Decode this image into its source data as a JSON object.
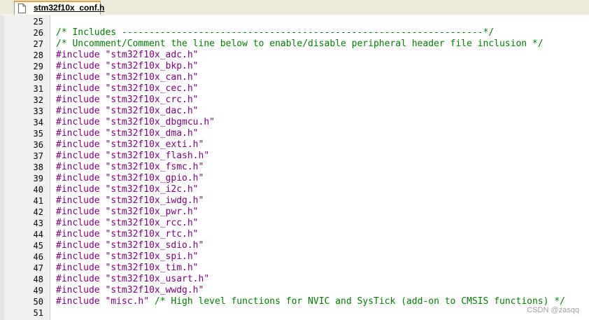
{
  "tab": {
    "filename": "stm32f10x_conf.h"
  },
  "lines": [
    {
      "num": "25",
      "parts": []
    },
    {
      "num": "26",
      "parts": [
        {
          "t": "cm",
          "v": "/* Includes ------------------------------------------------------------------*/"
        }
      ]
    },
    {
      "num": "27",
      "parts": [
        {
          "t": "cm",
          "v": "/* Uncomment/Comment the line below to enable/disable peripheral header file inclusion */"
        }
      ]
    },
    {
      "num": "28",
      "parts": [
        {
          "t": "kw",
          "v": "#include"
        },
        {
          "t": "sp",
          "v": " "
        },
        {
          "t": "str",
          "v": "\"stm32f10x_adc.h\""
        }
      ]
    },
    {
      "num": "29",
      "parts": [
        {
          "t": "kw",
          "v": "#include"
        },
        {
          "t": "sp",
          "v": " "
        },
        {
          "t": "str",
          "v": "\"stm32f10x_bkp.h\""
        }
      ]
    },
    {
      "num": "30",
      "parts": [
        {
          "t": "kw",
          "v": "#include"
        },
        {
          "t": "sp",
          "v": " "
        },
        {
          "t": "str",
          "v": "\"stm32f10x_can.h\""
        }
      ]
    },
    {
      "num": "31",
      "parts": [
        {
          "t": "kw",
          "v": "#include"
        },
        {
          "t": "sp",
          "v": " "
        },
        {
          "t": "str",
          "v": "\"stm32f10x_cec.h\""
        }
      ]
    },
    {
      "num": "32",
      "parts": [
        {
          "t": "kw",
          "v": "#include"
        },
        {
          "t": "sp",
          "v": " "
        },
        {
          "t": "str",
          "v": "\"stm32f10x_crc.h\""
        }
      ]
    },
    {
      "num": "33",
      "parts": [
        {
          "t": "kw",
          "v": "#include"
        },
        {
          "t": "sp",
          "v": " "
        },
        {
          "t": "str",
          "v": "\"stm32f10x_dac.h\""
        }
      ]
    },
    {
      "num": "34",
      "parts": [
        {
          "t": "kw",
          "v": "#include"
        },
        {
          "t": "sp",
          "v": " "
        },
        {
          "t": "str",
          "v": "\"stm32f10x_dbgmcu.h\""
        }
      ]
    },
    {
      "num": "35",
      "parts": [
        {
          "t": "kw",
          "v": "#include"
        },
        {
          "t": "sp",
          "v": " "
        },
        {
          "t": "str",
          "v": "\"stm32f10x_dma.h\""
        }
      ]
    },
    {
      "num": "36",
      "parts": [
        {
          "t": "kw",
          "v": "#include"
        },
        {
          "t": "sp",
          "v": " "
        },
        {
          "t": "str",
          "v": "\"stm32f10x_exti.h\""
        }
      ]
    },
    {
      "num": "37",
      "parts": [
        {
          "t": "kw",
          "v": "#include"
        },
        {
          "t": "sp",
          "v": " "
        },
        {
          "t": "str",
          "v": "\"stm32f10x_flash.h\""
        }
      ]
    },
    {
      "num": "38",
      "parts": [
        {
          "t": "kw",
          "v": "#include"
        },
        {
          "t": "sp",
          "v": " "
        },
        {
          "t": "str",
          "v": "\"stm32f10x_fsmc.h\""
        }
      ]
    },
    {
      "num": "39",
      "parts": [
        {
          "t": "kw",
          "v": "#include"
        },
        {
          "t": "sp",
          "v": " "
        },
        {
          "t": "str",
          "v": "\"stm32f10x_gpio.h\""
        }
      ]
    },
    {
      "num": "40",
      "parts": [
        {
          "t": "kw",
          "v": "#include"
        },
        {
          "t": "sp",
          "v": " "
        },
        {
          "t": "str",
          "v": "\"stm32f10x_i2c.h\""
        }
      ]
    },
    {
      "num": "41",
      "parts": [
        {
          "t": "kw",
          "v": "#include"
        },
        {
          "t": "sp",
          "v": " "
        },
        {
          "t": "str",
          "v": "\"stm32f10x_iwdg.h\""
        }
      ]
    },
    {
      "num": "42",
      "parts": [
        {
          "t": "kw",
          "v": "#include"
        },
        {
          "t": "sp",
          "v": " "
        },
        {
          "t": "str",
          "v": "\"stm32f10x_pwr.h\""
        }
      ]
    },
    {
      "num": "43",
      "parts": [
        {
          "t": "kw",
          "v": "#include"
        },
        {
          "t": "sp",
          "v": " "
        },
        {
          "t": "str",
          "v": "\"stm32f10x_rcc.h\""
        }
      ]
    },
    {
      "num": "44",
      "parts": [
        {
          "t": "kw",
          "v": "#include"
        },
        {
          "t": "sp",
          "v": " "
        },
        {
          "t": "str",
          "v": "\"stm32f10x_rtc.h\""
        }
      ]
    },
    {
      "num": "45",
      "parts": [
        {
          "t": "kw",
          "v": "#include"
        },
        {
          "t": "sp",
          "v": " "
        },
        {
          "t": "str",
          "v": "\"stm32f10x_sdio.h\""
        }
      ]
    },
    {
      "num": "46",
      "parts": [
        {
          "t": "kw",
          "v": "#include"
        },
        {
          "t": "sp",
          "v": " "
        },
        {
          "t": "str",
          "v": "\"stm32f10x_spi.h\""
        }
      ]
    },
    {
      "num": "47",
      "parts": [
        {
          "t": "kw",
          "v": "#include"
        },
        {
          "t": "sp",
          "v": " "
        },
        {
          "t": "str",
          "v": "\"stm32f10x_tim.h\""
        }
      ]
    },
    {
      "num": "48",
      "parts": [
        {
          "t": "kw",
          "v": "#include"
        },
        {
          "t": "sp",
          "v": " "
        },
        {
          "t": "str",
          "v": "\"stm32f10x_usart.h\""
        }
      ]
    },
    {
      "num": "49",
      "parts": [
        {
          "t": "kw",
          "v": "#include"
        },
        {
          "t": "sp",
          "v": " "
        },
        {
          "t": "str",
          "v": "\"stm32f10x_wwdg.h\""
        }
      ]
    },
    {
      "num": "50",
      "parts": [
        {
          "t": "kw",
          "v": "#include"
        },
        {
          "t": "sp",
          "v": " "
        },
        {
          "t": "str",
          "v": "\"misc.h\""
        },
        {
          "t": "sp",
          "v": " "
        },
        {
          "t": "cm",
          "v": "/* High level functions for NVIC and SysTick (add-on to CMSIS functions) */"
        }
      ]
    },
    {
      "num": "51",
      "parts": []
    }
  ],
  "watermark": "CSDN @zasqq",
  "colors": {
    "keyword": "#800080",
    "string": "#800080",
    "comment": "#008000",
    "tab_accent": "#e6a33d"
  },
  "icons": {
    "tab_icon": "file-icon"
  }
}
